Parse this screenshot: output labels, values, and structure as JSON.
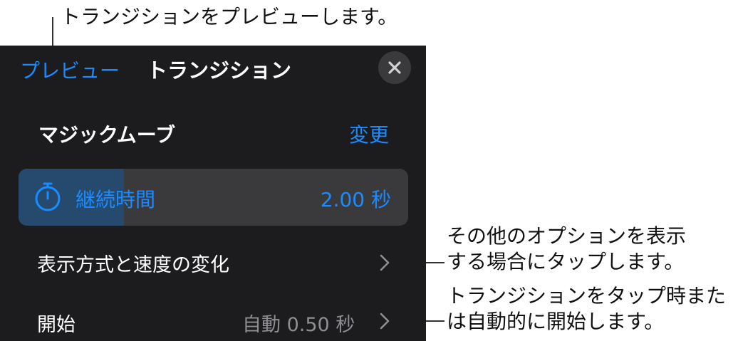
{
  "callouts": {
    "preview": "トランジションをプレビューします。",
    "options_line1": "その他のオプションを表示",
    "options_line2": "する場合にタップします。",
    "start_line1": "トランジションをタップ時また",
    "start_line2": "は自動的に開始します。"
  },
  "header": {
    "preview_label": "プレビュー",
    "title": "トランジション",
    "close_icon": "close-icon"
  },
  "effect": {
    "name": "マジックムーブ",
    "change_label": "変更"
  },
  "duration": {
    "label": "継続時間",
    "value": "2.00 秒",
    "icon": "stopwatch-icon",
    "slider_fraction": 0.27
  },
  "rows": {
    "delivery_label": "表示方式と速度の変化",
    "start_label": "開始",
    "start_value": "自動  0.50 秒"
  },
  "colors": {
    "panel_bg": "#1c1c1e",
    "accent": "#1a8cff",
    "secondary_text": "#8e8e93",
    "slider_track": "#3a3a3c",
    "slider_fill": "#264a6e"
  }
}
